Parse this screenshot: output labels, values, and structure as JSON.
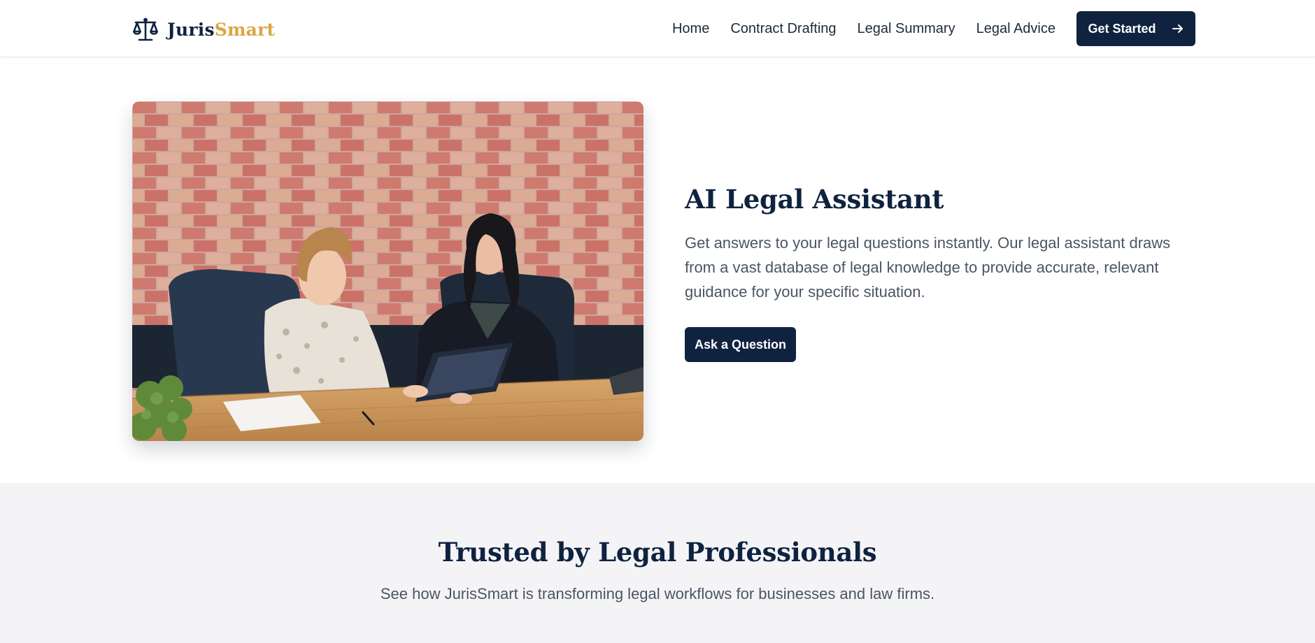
{
  "brand": {
    "name_part1": "Juris",
    "name_part2": "Smart",
    "logo_icon": "scales-of-justice-icon",
    "colors": {
      "navy": "#0f2340",
      "gold": "#d9a740"
    }
  },
  "nav": {
    "items": [
      {
        "label": "Home"
      },
      {
        "label": "Contract Drafting"
      },
      {
        "label": "Legal Summary"
      },
      {
        "label": "Legal Advice"
      }
    ],
    "cta_label": "Get Started",
    "cta_icon": "arrow-right-icon"
  },
  "hero": {
    "title": "AI Legal Assistant",
    "description": "Get answers to your legal questions instantly. Our legal assistant draws from a vast database of legal knowledge to provide accurate, relevant guidance for your specific situation.",
    "button_label": "Ask a Question"
  },
  "trusted": {
    "title": "Trusted by Legal Professionals",
    "subtitle": "See how JurisSmart is transforming legal workflows for businesses and law firms."
  }
}
